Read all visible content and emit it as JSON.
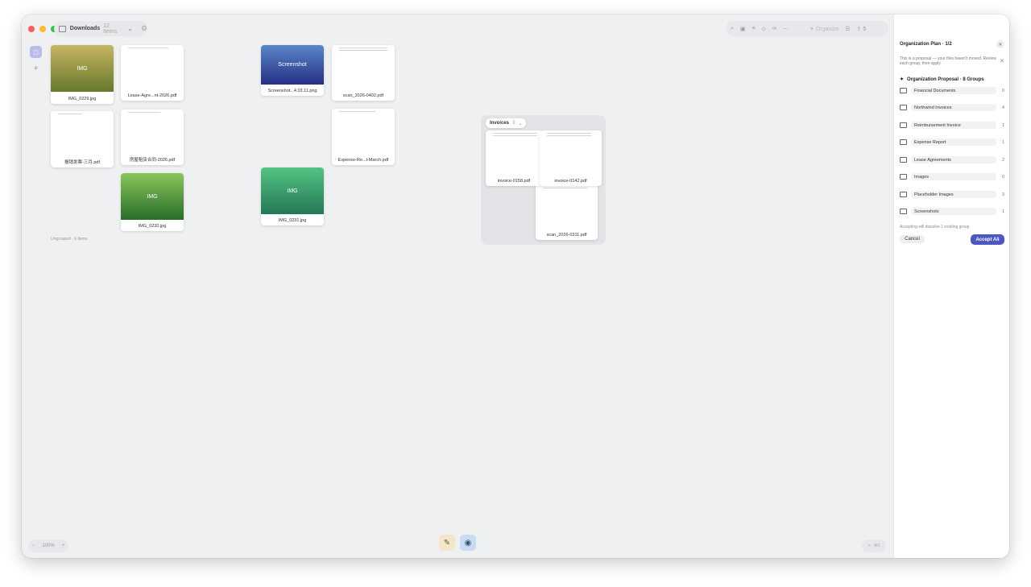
{
  "titlebar": {
    "folder": "Downloads",
    "item_count": "12 Items"
  },
  "toolbar": {
    "organize_label": "Organize",
    "extra": "5"
  },
  "canvas": {
    "ungrouped_label": "Ungrouped · 9 Items",
    "files": {
      "img_0229": {
        "thumb": "IMG",
        "name": "IMG_0229.jpg"
      },
      "lease": {
        "name": "Lease-Agre...nt-2026.pdf"
      },
      "screenshot": {
        "thumb": "Screenshot",
        "name": "Screenshot...4.03.11.png"
      },
      "scan0402": {
        "name": "scan_2026-0402.pdf"
      },
      "baoxiao": {
        "name": "报销发票-三月.pdf"
      },
      "fangwu": {
        "name": "房屋租赁合同-2026.pdf"
      },
      "expense": {
        "name": "Expense-Re...t-March.pdf"
      },
      "img_0230": {
        "thumb": "IMG",
        "name": "IMG_0230.jpg"
      },
      "img_0231": {
        "thumb": "IMG",
        "name": "IMG_0231.jpg"
      }
    },
    "group": {
      "name": "Invoices",
      "count": "3",
      "files": {
        "inv0158": "invoice-0158.pdf",
        "inv0142": "invoice-0142.pdf",
        "scan0311": "scan_2026-0311.pdf"
      }
    }
  },
  "zoom": {
    "minus": "−",
    "value": "100%",
    "plus": "+"
  },
  "bottom_right": {
    "label": "⌘0"
  },
  "panel": {
    "title": "Organization Plan · 1/2",
    "description": "This is a proposal — your files haven't moved. Review each group, then apply",
    "heading": "Organization Proposal · 8 Groups",
    "groups": [
      {
        "label": "Financial Documents",
        "count": "0"
      },
      {
        "label": "Northwind Invoices",
        "count": "4"
      },
      {
        "label": "Reimbursement Invoice",
        "count": "1"
      },
      {
        "label": "Expense Report",
        "count": "1"
      },
      {
        "label": "Lease Agreements",
        "count": "2"
      },
      {
        "label": "Images",
        "count": "0"
      },
      {
        "label": "Placeholder Images",
        "count": "3"
      },
      {
        "label": "Screenshots",
        "count": "1"
      }
    ],
    "note": "Accepting will dissolve 1 existing group",
    "cancel": "Cancel",
    "accept": "Accept All"
  }
}
